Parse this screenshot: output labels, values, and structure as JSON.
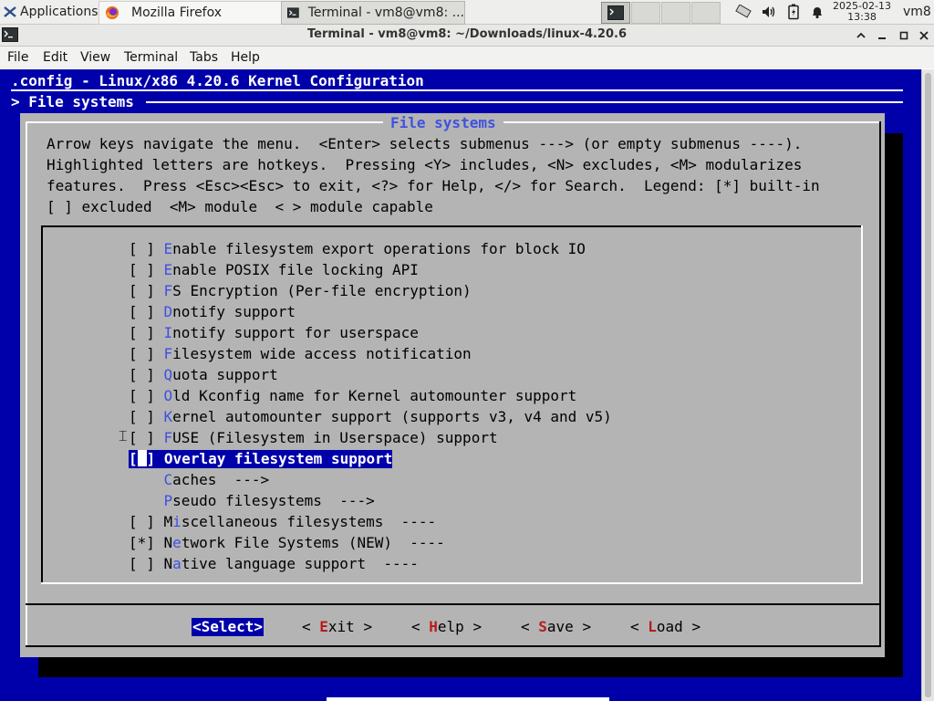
{
  "taskbar": {
    "apps_label": "Applications",
    "firefox_label": "Mozilla Firefox",
    "terminal_label": "Terminal - vm8@vm8: ...",
    "date": "2025-02-13",
    "time": "13:38",
    "user": "vm8"
  },
  "window": {
    "title": "Terminal - vm8@vm8: ~/Downloads/linux-4.20.6"
  },
  "menubar": {
    "items": [
      "File",
      "Edit",
      "View",
      "Terminal",
      "Tabs",
      "Help"
    ]
  },
  "terminal": {
    "header": ".config - Linux/x86 4.20.6 Kernel Configuration",
    "breadcrumb": "> File systems"
  },
  "dialog": {
    "title": "File systems",
    "help_lines": [
      "Arrow keys navigate the menu.  <Enter> selects submenus ---> (or empty submenus ----).",
      "Highlighted letters are hotkeys.  Pressing <Y> includes, <N> excludes, <M> modularizes",
      "features.  Press <Esc><Esc> to exit, <?> for Help, </> for Search.  Legend: [*] built-in",
      "[ ] excluded  <M> module  < > module capable"
    ],
    "selected_index": 10,
    "items": [
      {
        "prefix": "[ ] ",
        "hotkey": "E",
        "rest": "nable filesystem export operations for block IO"
      },
      {
        "prefix": "[ ] ",
        "hotkey": "E",
        "rest": "nable POSIX file locking API"
      },
      {
        "prefix": "[ ] ",
        "hotkey": "F",
        "rest": "S Encryption (Per-file encryption)"
      },
      {
        "prefix": "[ ] ",
        "hotkey": "D",
        "rest": "notify support"
      },
      {
        "prefix": "[ ] ",
        "hotkey": "I",
        "rest": "notify support for userspace"
      },
      {
        "prefix": "[ ] ",
        "hotkey": "F",
        "rest": "ilesystem wide access notification"
      },
      {
        "prefix": "[ ] ",
        "hotkey": "Q",
        "rest": "uota support"
      },
      {
        "prefix": "[ ] ",
        "hotkey": "O",
        "rest": "ld Kconfig name for Kernel automounter support"
      },
      {
        "prefix": "[ ] ",
        "hotkey": "K",
        "rest": "ernel automounter support (supports v3, v4 and v5)"
      },
      {
        "prefix": "[ ] ",
        "hotkey": "F",
        "rest": "USE (Filesystem in Userspace) support"
      },
      {
        "prefix": "[",
        "cursor": true,
        "after_cursor": "] ",
        "hotkey": "O",
        "rest": "verlay filesystem support"
      },
      {
        "prefix": "    ",
        "hotkey": "C",
        "rest": "aches  --->"
      },
      {
        "prefix": "    ",
        "hotkey": "P",
        "rest": "seudo filesystems  --->"
      },
      {
        "prefix": "[ ] M",
        "hotkey": "i",
        "rest": "scellaneous filesystems  ----"
      },
      {
        "prefix": "[*] N",
        "hotkey": "e",
        "rest": "twork File Systems (NEW)  ----"
      },
      {
        "prefix": "[ ] N",
        "hotkey": "a",
        "rest": "tive language support  ----"
      }
    ],
    "buttons": [
      {
        "label": "<Select>",
        "active": true
      },
      {
        "pre": "< ",
        "key": "E",
        "post": "xit >"
      },
      {
        "pre": "< ",
        "key": "H",
        "post": "elp >"
      },
      {
        "pre": "< ",
        "key": "S",
        "post": "ave >"
      },
      {
        "pre": "< ",
        "key": "L",
        "post": "oad >"
      }
    ]
  },
  "colors": {
    "terminal_bg": "#0000aa",
    "dialog_bg": "#b4b4b4",
    "hotkey": "#3f51e0",
    "button_key": "#b71c1c"
  },
  "icons": [
    "terminal-icon",
    "firefox-icon",
    "network-icon",
    "volume-icon",
    "battery-icon",
    "notification-bell-icon",
    "ibeam-cursor-icon"
  ]
}
